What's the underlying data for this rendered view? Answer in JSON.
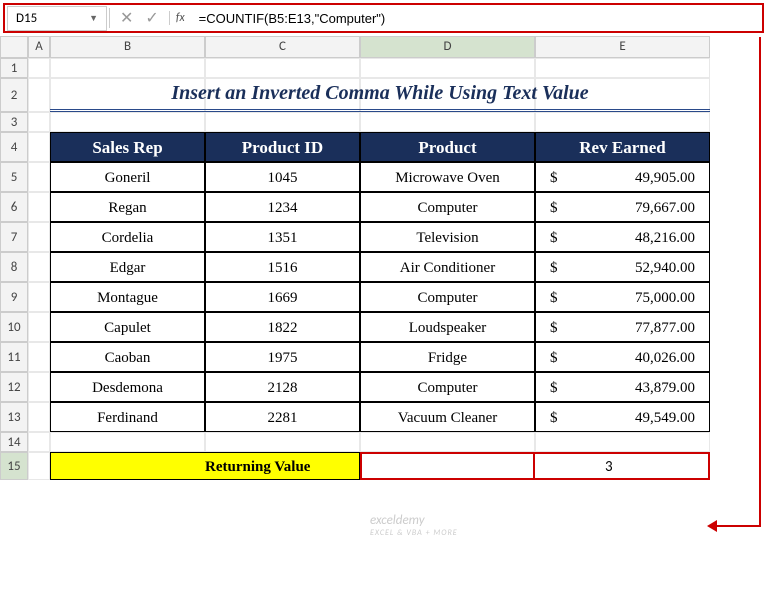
{
  "name_box": "D15",
  "fx_label": "fx",
  "formula": "=COUNTIF(B5:E13,\"Computer\")",
  "col_headers": [
    "A",
    "B",
    "C",
    "D",
    "E"
  ],
  "title": "Insert an Inverted Comma While Using Text Value",
  "table": {
    "headers": [
      "Sales Rep",
      "Product ID",
      "Product",
      "Rev Earned"
    ],
    "rows": [
      {
        "rep": "Goneril",
        "id": "1045",
        "prod": "Microwave Oven",
        "rev": "49,905.00"
      },
      {
        "rep": "Regan",
        "id": "1234",
        "prod": "Computer",
        "rev": "79,667.00"
      },
      {
        "rep": "Cordelia",
        "id": "1351",
        "prod": "Television",
        "rev": "48,216.00"
      },
      {
        "rep": "Edgar",
        "id": "1516",
        "prod": "Air Conditioner",
        "rev": "52,940.00"
      },
      {
        "rep": "Montague",
        "id": "1669",
        "prod": "Computer",
        "rev": "75,000.00"
      },
      {
        "rep": "Capulet",
        "id": "1822",
        "prod": "Loudspeaker",
        "rev": "77,877.00"
      },
      {
        "rep": "Caoban",
        "id": "1975",
        "prod": "Fridge",
        "rev": "40,026.00"
      },
      {
        "rep": "Desdemona",
        "id": "2128",
        "prod": "Computer",
        "rev": "43,879.00"
      },
      {
        "rep": "Ferdinand",
        "id": "2281",
        "prod": "Vacuum Cleaner",
        "rev": "49,549.00"
      }
    ]
  },
  "returning": {
    "label": "Returning Value",
    "value": "3"
  },
  "watermark": {
    "main": "exceldemy",
    "sub": "EXCEL & VBA + MORE"
  }
}
